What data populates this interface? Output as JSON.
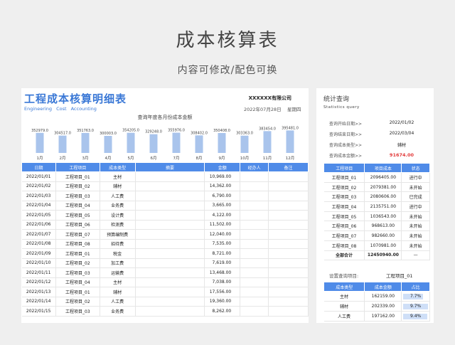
{
  "hero": {
    "title": "成本核算表",
    "subtitle": "内容可修改/配色可换"
  },
  "left_panel": {
    "title": "工程成本核算明细表",
    "subtitle": "Engineering Cost Accounting",
    "company": "XXXXXX有限公司",
    "date": "2022年07月28日",
    "weekday": "星期四",
    "chart_title": "查询年度各月份成本金额"
  },
  "chart_data": {
    "type": "bar",
    "title": "查询年度各月份成本金额",
    "categories": [
      "1月",
      "2月",
      "3月",
      "4月",
      "5月",
      "6月",
      "7月",
      "8月",
      "9月",
      "10月",
      "11月",
      "12月"
    ],
    "values": [
      352979.0,
      304517.0,
      351763.0,
      300003.0,
      354205.0,
      329248.0,
      355976.0,
      308402.0,
      350408.0,
      303363.0,
      383454.0,
      395481.0
    ],
    "value_labels": [
      "352979.0",
      "304517.0",
      "351763.0",
      "300003.0",
      "354205.0",
      "329248.0",
      "355976.0",
      "308402.0",
      "350408.0",
      "303363.0",
      "383454.0",
      "395481.0"
    ],
    "color": "#a9c4ec"
  },
  "main_table": {
    "headers": [
      "日期",
      "工程项目",
      "成本类型",
      "摘要",
      "金额",
      "经办人",
      "备注"
    ],
    "rows": [
      [
        "2022/01/01",
        "工程项目_01",
        "主材",
        "",
        "10,969.00",
        "",
        ""
      ],
      [
        "2022/01/02",
        "工程项目_02",
        "辅材",
        "",
        "14,362.00",
        "",
        ""
      ],
      [
        "2022/01/03",
        "工程项目_03",
        "人工费",
        "",
        "6,790.00",
        "",
        ""
      ],
      [
        "2022/01/04",
        "工程项目_04",
        "业务费",
        "",
        "3,665.00",
        "",
        ""
      ],
      [
        "2022/01/05",
        "工程项目_05",
        "设计费",
        "",
        "4,122.00",
        "",
        ""
      ],
      [
        "2022/01/06",
        "工程项目_06",
        "检测费",
        "",
        "11,502.00",
        "",
        ""
      ],
      [
        "2022/01/07",
        "工程项目_07",
        "预算编制费",
        "",
        "12,040.00",
        "",
        ""
      ],
      [
        "2022/01/08",
        "工程项目_08",
        "招待费",
        "",
        "7,535.00",
        "",
        ""
      ],
      [
        "2022/01/09",
        "工程项目_01",
        "税金",
        "",
        "8,721.00",
        "",
        ""
      ],
      [
        "2022/01/10",
        "工程项目_02",
        "加工费",
        "",
        "7,619.00",
        "",
        ""
      ],
      [
        "2022/01/11",
        "工程项目_03",
        "运输费",
        "",
        "13,468.00",
        "",
        ""
      ],
      [
        "2022/01/12",
        "工程项目_04",
        "主材",
        "",
        "7,038.00",
        "",
        ""
      ],
      [
        "2022/01/13",
        "工程项目_01",
        "辅材",
        "",
        "17,556.00",
        "",
        ""
      ],
      [
        "2022/01/14",
        "工程项目_02",
        "人工费",
        "",
        "19,360.00",
        "",
        ""
      ],
      [
        "2022/01/15",
        "工程项目_03",
        "业务费",
        "",
        "8,262.00",
        "",
        ""
      ]
    ]
  },
  "right_panel": {
    "title": "统计查询",
    "subtitle": "Statistics query",
    "query": [
      {
        "label": "查询开始日期>>",
        "value": "2022/01/02"
      },
      {
        "label": "查询结束日期>>",
        "value": "2022/03/04"
      },
      {
        "label": "查询成本类型>>",
        "value": "辅材"
      },
      {
        "label": "查询成本金额>>",
        "value": "91674.00"
      }
    ],
    "stat_headers": [
      "工程项目",
      "项目成本",
      "状态"
    ],
    "stat_rows": [
      {
        "project": "工程项目_01",
        "cost": "2096405.00",
        "status": "进行中",
        "kind": "blue"
      },
      {
        "project": "工程项目_02",
        "cost": "2079381.00",
        "status": "未开始",
        "kind": "gray"
      },
      {
        "project": "工程项目_03",
        "cost": "2080606.00",
        "status": "已完成",
        "kind": "green"
      },
      {
        "project": "工程项目_04",
        "cost": "2135751.00",
        "status": "进行中",
        "kind": "blue"
      },
      {
        "project": "工程项目_05",
        "cost": "1036543.00",
        "status": "未开始",
        "kind": "gray"
      },
      {
        "project": "工程项目_06",
        "cost": "968613.00",
        "status": "未开始",
        "kind": "gray"
      },
      {
        "project": "工程项目_07",
        "cost": "982660.00",
        "status": "未开始",
        "kind": "gray"
      },
      {
        "project": "工程项目_08",
        "cost": "1070981.00",
        "status": "未开始",
        "kind": "gray"
      },
      {
        "project": "全部合计",
        "cost": "12450940.00",
        "status": "—",
        "kind": "normal"
      }
    ],
    "select_label": "设置查询项目:",
    "select_value": "工程项目_01",
    "pct_headers": [
      "成本类型",
      "成本金额",
      "占比"
    ],
    "pct_rows": [
      {
        "type": "主材",
        "amount": "162159.00",
        "pct": "7.7%",
        "fraction": 0.077
      },
      {
        "type": "辅材",
        "amount": "202339.00",
        "pct": "9.7%",
        "fraction": 0.097
      },
      {
        "type": "人工费",
        "amount": "197162.00",
        "pct": "9.4%",
        "fraction": 0.094
      }
    ]
  },
  "colors": {
    "accent": "#3a78d6",
    "header": "#4f8be8",
    "bar": "#a9c4ec",
    "red": "#e23b3b",
    "green": "#1fae3a"
  }
}
